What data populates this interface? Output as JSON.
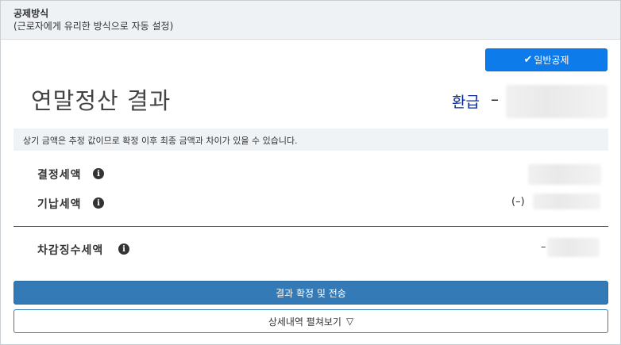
{
  "header": {
    "title": "공제방식",
    "subtitle": "(근로자에게 유리한 방식으로 자동 설정)"
  },
  "mode_button": {
    "icon": "check-icon",
    "label": "일반공제",
    "color": "#0d7bea"
  },
  "result": {
    "title": "연말정산 결과",
    "refund_label": "환급",
    "refund_dash": "–"
  },
  "notice": {
    "text": "상기 금액은 추정 값이므로 확정 이후 최종 금액과 차이가 있을 수 있습니다."
  },
  "rows": {
    "determined_tax": {
      "label": "결정세액",
      "icon": "info-icon"
    },
    "prepaid_tax": {
      "label": "기납세액",
      "icon": "info-icon",
      "prefix": "(–)"
    },
    "difference_tax": {
      "label": "차감징수세액",
      "icon": "info-icon",
      "prefix": "–"
    }
  },
  "buttons": {
    "confirm_label": "결과 확정 및 전송",
    "confirm_color": "#337ab7",
    "details_label": "상세내역 펼쳐보기",
    "details_icon": "▽"
  }
}
